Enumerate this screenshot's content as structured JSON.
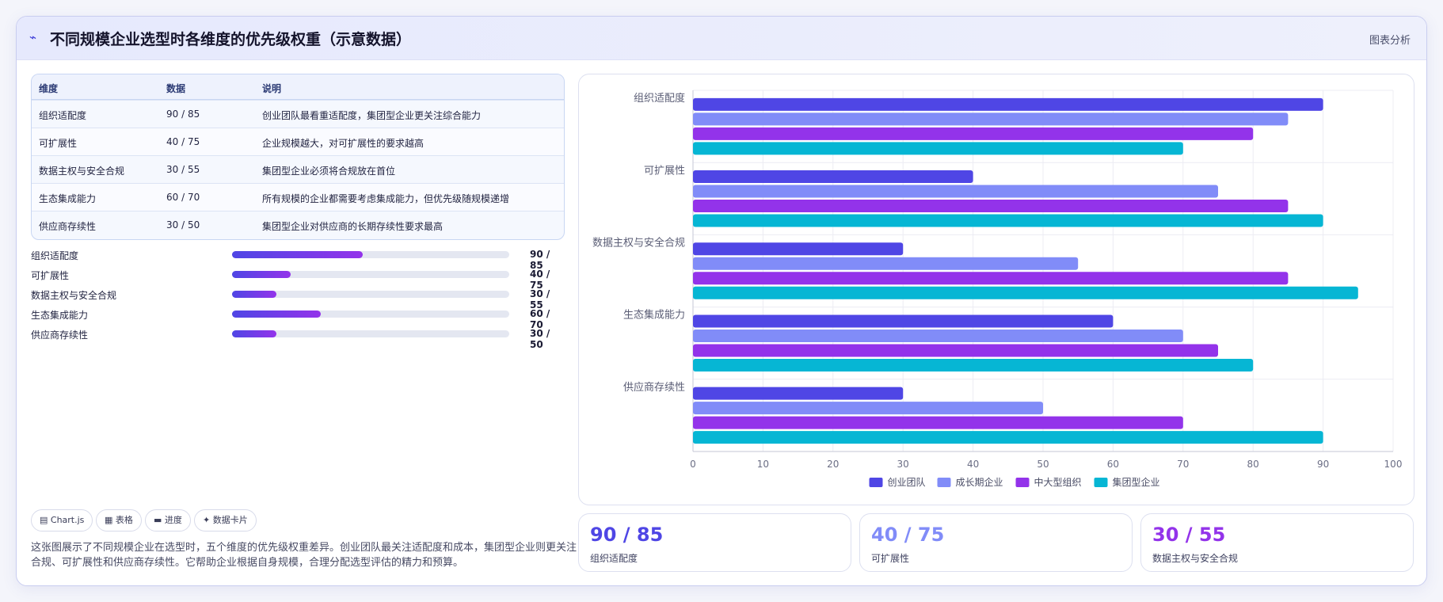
{
  "header": {
    "icon": "trend-line-icon",
    "title": "不同规模企业选型时各维度的优先级权重（示意数据）",
    "badge": "图表分析"
  },
  "table": {
    "columns": [
      "维度",
      "数据",
      "说明"
    ],
    "rows": [
      [
        "组织适配度",
        "90 / 85",
        "创业团队最看重适配度，集团型企业更关注综合能力"
      ],
      [
        "可扩展性",
        "40 / 75",
        "企业规模越大，对可扩展性的要求越高"
      ],
      [
        "数据主权与安全合规",
        "30 / 55",
        "集团型企业必须将合规放在首位"
      ],
      [
        "生态集成能力",
        "60 / 70",
        "所有规模的企业都需要考虑集成能力，但优先级随规模递增"
      ],
      [
        "供应商存续性",
        "30 / 50",
        "集团型企业对供应商的长期存续性要求最高"
      ]
    ]
  },
  "progress": [
    {
      "label": "组织适配度",
      "value": "90 / 85",
      "fill": 0.47
    },
    {
      "label": "可扩展性",
      "value": "40 / 75",
      "fill": 0.21
    },
    {
      "label": "数据主权与安全合规",
      "value": "30 / 55",
      "fill": 0.16
    },
    {
      "label": "生态集成能力",
      "value": "60 / 70",
      "fill": 0.32
    },
    {
      "label": "供应商存续性",
      "value": "30 / 50",
      "fill": 0.16
    }
  ],
  "tags": [
    {
      "icon": "chart-icon",
      "label": "▤ Chart.js"
    },
    {
      "icon": "table-icon",
      "label": "▦ 表格"
    },
    {
      "icon": "progress-icon",
      "label": "▬ 进度"
    },
    {
      "icon": "card-icon",
      "label": "✦ 数据卡片"
    }
  ],
  "description": "这张图展示了不同规模企业在选型时，五个维度的优先级权重差异。创业团队最关注适配度和成本，集团型企业则更关注合规、可扩展性和供应商存续性。它帮助企业根据自身规模，合理分配选型评估的精力和预算。",
  "stats": [
    {
      "value": "90 / 85",
      "label": "组织适配度",
      "color": "#4f46e5"
    },
    {
      "value": "40 / 75",
      "label": "可扩展性",
      "color": "#818cf8"
    },
    {
      "value": "30 / 55",
      "label": "数据主权与安全合规",
      "color": "#9333ea"
    }
  ],
  "chart_data": {
    "type": "bar",
    "orientation": "horizontal",
    "categories": [
      "组织适配度",
      "可扩展性",
      "数据主权与安全合规",
      "生态集成能力",
      "供应商存续性"
    ],
    "series": [
      {
        "name": "创业团队",
        "values": [
          90,
          40,
          30,
          60,
          30
        ],
        "color": "#4f46e5"
      },
      {
        "name": "成长期企业",
        "values": [
          85,
          75,
          55,
          70,
          50
        ],
        "color": "#818cf8"
      },
      {
        "name": "中大型组织",
        "values": [
          80,
          85,
          85,
          75,
          70
        ],
        "color": "#9333ea"
      },
      {
        "name": "集团型企业",
        "values": [
          70,
          90,
          95,
          80,
          90
        ],
        "color": "#06b6d4"
      }
    ],
    "xlim": [
      0,
      100
    ],
    "xticks": [
      0,
      10,
      20,
      30,
      40,
      50,
      60,
      70,
      80,
      90,
      100
    ],
    "grid": true,
    "legend": "bottom"
  }
}
